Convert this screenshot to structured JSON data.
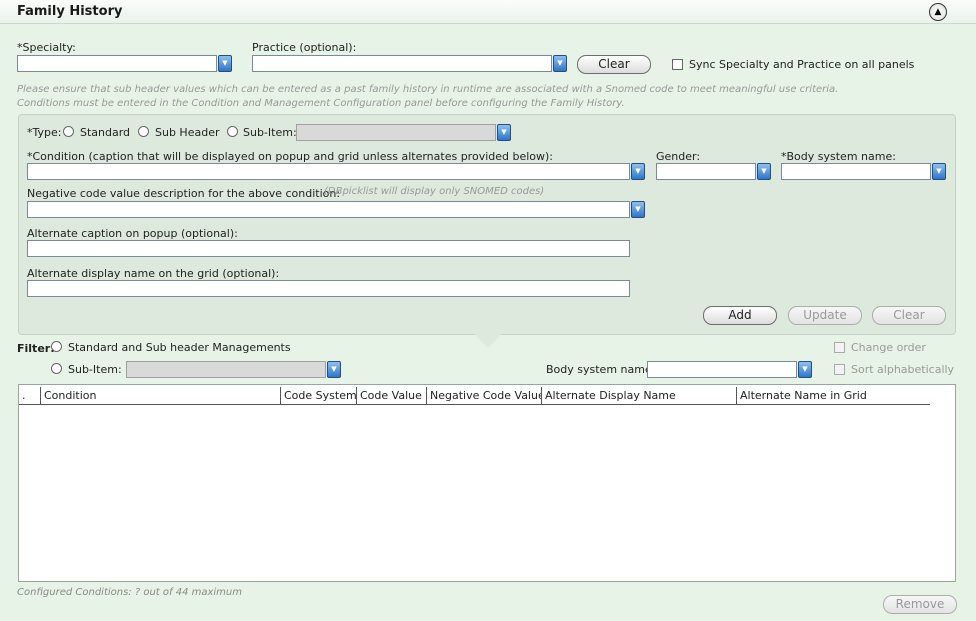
{
  "header": {
    "title": "Family History",
    "collapse_icon": "collapse-up-icon"
  },
  "top": {
    "specialty_label": "*Specialty:",
    "specialty_value": "",
    "practice_label": "Practice (optional):",
    "practice_value": "",
    "clear_label": "Clear",
    "sync_label": "Sync Specialty and Practice on all panels",
    "sync_checked": false,
    "note_line1": "Please ensure that sub header values which can be entered as a past family history in runtime are associated with a Snomed code to meet meaningful use criteria.",
    "note_line2": "Conditions must be entered in the Condition and Management Configuration panel before configuring the Family History."
  },
  "form": {
    "type_label": "*Type:",
    "type_options": [
      "Standard",
      "Sub Header",
      "Sub-Item:"
    ],
    "type_selected": "",
    "subitem_value": "",
    "condition_label": "*Condition (caption that will be displayed on popup and grid unless alternates provided below):",
    "condition_value": "",
    "gender_label": "Gender:",
    "gender_value": "",
    "body_system_label": "*Body system name:",
    "body_system_value": "",
    "negative_label": "Negative code value description for the above condition:",
    "negative_hint": "(DBpicklist will display only SNOMED codes)",
    "negative_value": "",
    "alt_caption_label": "Alternate caption on popup (optional):",
    "alt_caption_value": "",
    "alt_display_label": "Alternate display name on the grid (optional):",
    "alt_display_value": "",
    "add_label": "Add",
    "update_label": "Update",
    "clear_label": "Clear"
  },
  "filter": {
    "label": "Filter:",
    "option1": "Standard and Sub header Managements",
    "option2": "Sub-Item:",
    "subitem_value": "",
    "body_system_label": "Body system name:",
    "body_system_value": "",
    "change_order_label": "Change order",
    "sort_label": "Sort alphabetically"
  },
  "grid": {
    "columns": [
      ".",
      "Condition",
      "Code System",
      "Code Value",
      "Negative Code Value",
      "Alternate Display Name",
      "Alternate Name in Grid"
    ],
    "rows": []
  },
  "footer": {
    "configured_text": "Configured Conditions: ? out of 44 maximum",
    "remove_label": "Remove"
  }
}
